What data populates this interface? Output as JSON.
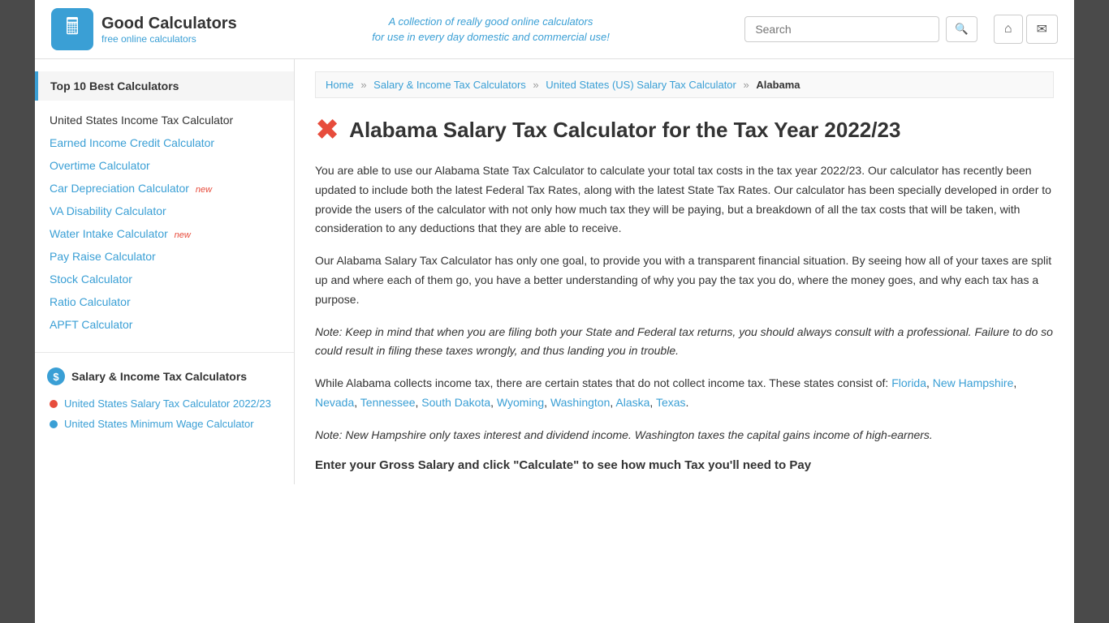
{
  "header": {
    "logo_icon": "🖩",
    "brand_name": "Good Calculators",
    "brand_sub": "free online calculators",
    "tagline_line1": "A collection of really good online calculators",
    "tagline_line2": "for use in every day domestic and commercial use!",
    "search_placeholder": "Search",
    "home_icon": "⌂",
    "mail_icon": "✉"
  },
  "sidebar": {
    "top_section_title": "Top 10 Best Calculators",
    "items": [
      {
        "label": "United States Income Tax Calculator",
        "href": "#",
        "plain": true,
        "badge": ""
      },
      {
        "label": "Earned Income Credit Calculator",
        "href": "#",
        "plain": false,
        "badge": ""
      },
      {
        "label": "Overtime Calculator",
        "href": "#",
        "plain": false,
        "badge": ""
      },
      {
        "label": "Car Depreciation Calculator",
        "href": "#",
        "plain": false,
        "badge": "new"
      },
      {
        "label": "VA Disability Calculator",
        "href": "#",
        "plain": false,
        "badge": ""
      },
      {
        "label": "Water Intake Calculator",
        "href": "#",
        "plain": false,
        "badge": "new"
      },
      {
        "label": "Pay Raise Calculator",
        "href": "#",
        "plain": false,
        "badge": ""
      },
      {
        "label": "Stock Calculator",
        "href": "#",
        "plain": false,
        "badge": ""
      },
      {
        "label": "Ratio Calculator",
        "href": "#",
        "plain": false,
        "badge": ""
      },
      {
        "label": "APFT Calculator",
        "href": "#",
        "plain": false,
        "badge": ""
      }
    ],
    "section2_title": "Salary & Income Tax Calculators",
    "sub_items": [
      {
        "label": "United States Salary Tax Calculator 2022/23",
        "href": "#",
        "dot": "red"
      },
      {
        "label": "United States Minimum Wage Calculator",
        "href": "#",
        "dot": "blue"
      }
    ]
  },
  "breadcrumb": {
    "items": [
      {
        "label": "Home",
        "href": "#"
      },
      {
        "label": "Salary & Income Tax Calculators",
        "href": "#"
      },
      {
        "label": "United States (US) Salary Tax Calculator",
        "href": "#"
      },
      {
        "label": "Alabama",
        "current": true
      }
    ]
  },
  "main": {
    "page_title": "Alabama Salary Tax Calculator for the Tax Year 2022/23",
    "paragraph1": "You are able to use our Alabama State Tax Calculator to calculate your total tax costs in the tax year 2022/23. Our calculator has recently been updated to include both the latest Federal Tax Rates, along with the latest State Tax Rates. Our calculator has been specially developed in order to provide the users of the calculator with not only how much tax they will be paying, but a breakdown of all the tax costs that will be taken, with consideration to any deductions that they are able to receive.",
    "paragraph2": "Our Alabama Salary Tax Calculator has only one goal, to provide you with a transparent financial situation. By seeing how all of your taxes are split up and where each of them go, you have a better understanding of why you pay the tax you do, where the money goes, and why each tax has a purpose.",
    "note1": "Note: Keep in mind that when you are filing both your State and Federal tax returns, you should always consult with a professional. Failure to do so could result in filing these taxes wrongly, and thus landing you in trouble.",
    "paragraph3_prefix": "While Alabama collects income tax, there are certain states that do not collect income tax. These states consist of: ",
    "no_tax_states": [
      {
        "label": "Florida",
        "href": "#"
      },
      {
        "label": "New Hampshire",
        "href": "#"
      },
      {
        "label": "Nevada",
        "href": "#"
      },
      {
        "label": "Tennessee",
        "href": "#"
      },
      {
        "label": "South Dakota",
        "href": "#"
      },
      {
        "label": "Wyoming",
        "href": "#"
      },
      {
        "label": "Washington",
        "href": "#"
      },
      {
        "label": "Alaska",
        "href": "#"
      },
      {
        "label": "Texas",
        "href": "#"
      }
    ],
    "note2": "Note: New Hampshire only taxes interest and dividend income. Washington taxes the capital gains income of high-earners.",
    "section_heading": "Enter your Gross Salary and click \"Calculate\" to see how much Tax you'll need to Pay"
  }
}
